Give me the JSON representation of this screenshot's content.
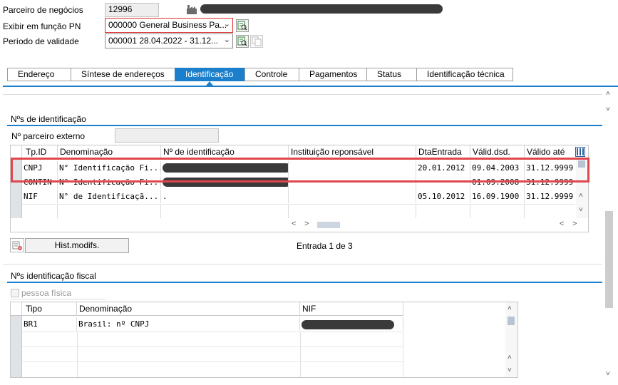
{
  "header": {
    "bp_label": "Parceiro de negócios",
    "bp_value": "12996",
    "role_label": "Exibir em função PN",
    "role_value": "000000 General Business Pa...",
    "validity_label": "Período de validade",
    "validity_value": "000001 28.04.2022 - 31.12..."
  },
  "tabs": [
    {
      "label": "Endereço"
    },
    {
      "label": "Síntese de endereços"
    },
    {
      "label": "Identificação"
    },
    {
      "label": "Controle"
    },
    {
      "label": "Pagamentos"
    },
    {
      "label": "Status"
    },
    {
      "label": "Identificação técnica"
    }
  ],
  "ids_section": {
    "title": "Nºs de identificação",
    "ext_partner_label": "Nº parceiro externo",
    "ext_partner_value": "",
    "columns": [
      "Tp.ID",
      "Denominação",
      "Nº de identificação",
      "Instituição reponsável",
      "DtaEntrada",
      "Válid.dsd.",
      "Válido até"
    ],
    "rows": [
      {
        "type": "CNPJ",
        "desc": "N° Identificação Fi...",
        "number": "",
        "institution": "",
        "entry": "20.01.2012",
        "from": "09.04.2003",
        "to": "31.12.9999"
      },
      {
        "type": "CONTIN",
        "desc": "N° Identificação Fi...",
        "number": "",
        "institution": "",
        "entry": "",
        "from": "01.09.2008",
        "to": "31.12.9999"
      },
      {
        "type": "NIF",
        "desc": "N°  de Identificaçã...",
        "number": ".",
        "institution": "",
        "entry": "05.10.2012",
        "from": "16.09.1900",
        "to": "31.12.9999"
      }
    ],
    "hist_button": "Hist.modifs.",
    "entry_counter": "Entrada 1 de 3"
  },
  "tax_section": {
    "title": "Nºs identificação fiscal",
    "natural_person_label": "pessoa física",
    "columns": [
      "Tipo",
      "Denominação",
      "NIF"
    ],
    "rows": [
      {
        "type": "BR1",
        "desc": "Brasil: nº CNPJ",
        "nif": ""
      }
    ]
  },
  "colors": {
    "accent": "#1b7fcc",
    "highlight_red": "#e0474c"
  }
}
